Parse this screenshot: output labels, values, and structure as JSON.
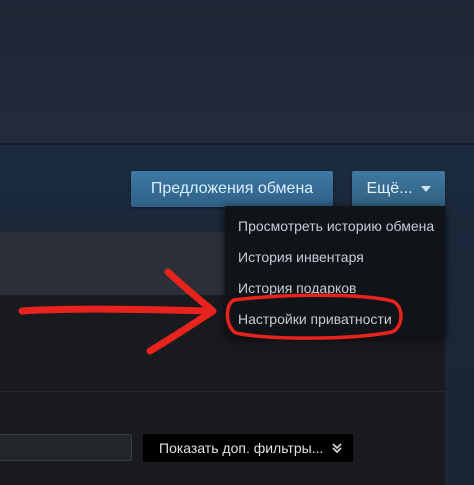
{
  "header": {
    "trade_offers_label": "Предложения обмена",
    "more_label": "Ещё..."
  },
  "more_menu": {
    "items": [
      {
        "label": "Просмотреть историю обмена"
      },
      {
        "label": "История инвентаря"
      },
      {
        "label": "История подарков"
      },
      {
        "label": "Настройки приватности"
      }
    ]
  },
  "filters": {
    "search_value": "",
    "more_filters_label": "Показать доп. фильтры..."
  },
  "colors": {
    "page_background": "#1b2838",
    "button_blue": "#3e7aa6",
    "annotation_red": "#e8231e"
  },
  "icons": {
    "more_caret": "caret-down-icon",
    "filters_chevron": "double-chevron-down-icon",
    "annotation_arrow": "red-arrow-annotation",
    "annotation_circle": "red-circle-annotation"
  }
}
